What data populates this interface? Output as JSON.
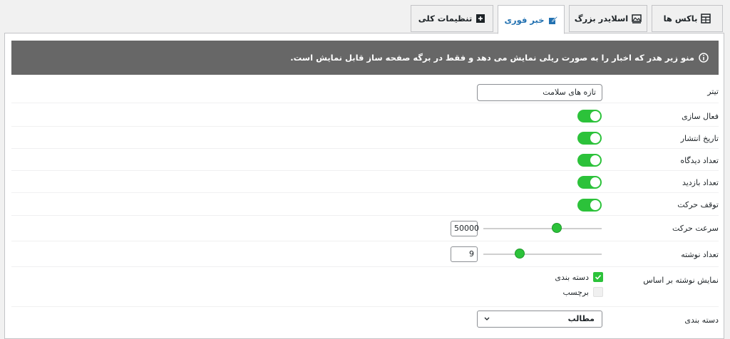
{
  "tabs": [
    {
      "label": "باکس ها",
      "icon": "table-icon",
      "active": false
    },
    {
      "label": "اسلایدر بزرگ",
      "icon": "slider-image-icon",
      "active": false
    },
    {
      "label": "خبر فوری",
      "icon": "edit-icon",
      "active": true
    },
    {
      "label": "تنظیمات کلی",
      "icon": "plus-box-icon",
      "active": false
    }
  ],
  "notice": {
    "icon": "info-icon",
    "text": "منو زیر هدر که اخبار را به صورت ریلی نمایش می دهد و فقط در برگه صفحه ساز قابل نمایش است."
  },
  "fields": {
    "title": {
      "label": "تیتر",
      "value": "تازه های سلامت"
    },
    "enable": {
      "label": "فعال سازی",
      "on": true
    },
    "publish_date": {
      "label": "تاریخ انتشار",
      "on": true
    },
    "comments_count": {
      "label": "تعداد دیدگاه",
      "on": true
    },
    "views_count": {
      "label": "تعداد بازدید",
      "on": true
    },
    "pause_motion": {
      "label": "توقف حرکت",
      "on": true
    },
    "speed": {
      "label": "سرعت حرکت",
      "value": "50000",
      "fraction": 0.38
    },
    "posts_count": {
      "label": "تعداد نوشته",
      "value": "9",
      "fraction": 0.69
    },
    "show_by": {
      "label": "نمایش نوشته بر اساس",
      "options": [
        {
          "label": "دسته بندی",
          "checked": true
        },
        {
          "label": "برچسب",
          "checked": false
        }
      ]
    },
    "category": {
      "label": "دسته بندی",
      "value": "مطالب"
    }
  },
  "colors": {
    "accent": "#2cc23a",
    "notice_bg": "#676767",
    "active_tab_text": "#2271b1"
  }
}
